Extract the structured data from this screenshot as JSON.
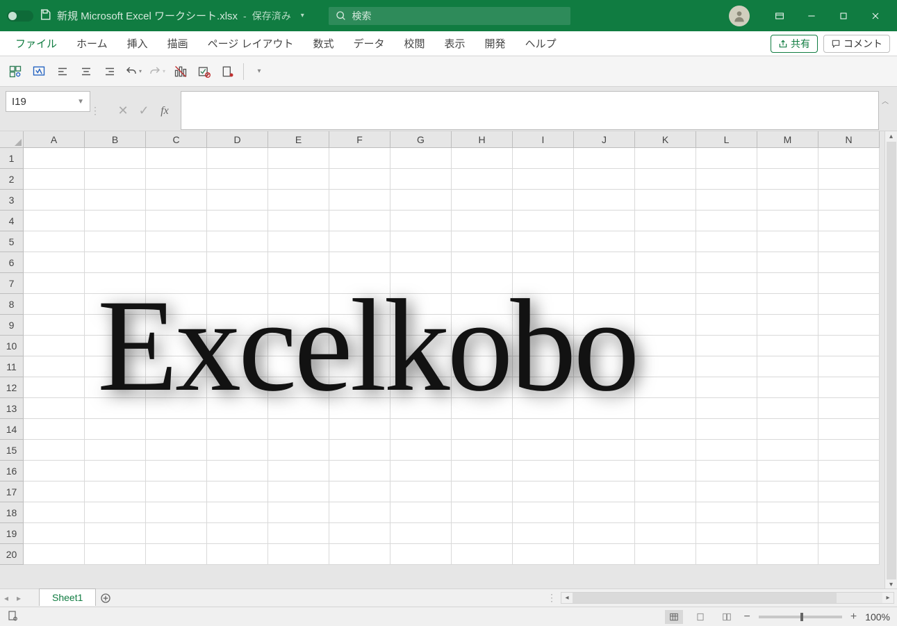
{
  "title_bar": {
    "file_name": "新規 Microsoft Excel ワークシート.xlsx",
    "save_status": "保存済み"
  },
  "search": {
    "placeholder": "検索"
  },
  "ribbon": {
    "tabs": [
      "ファイル",
      "ホーム",
      "挿入",
      "描画",
      "ページ レイアウト",
      "数式",
      "データ",
      "校閲",
      "表示",
      "開発",
      "ヘルプ"
    ],
    "share": "共有",
    "comments": "コメント"
  },
  "formula_bar": {
    "name_box": "I19",
    "formula": ""
  },
  "grid": {
    "columns": [
      "A",
      "B",
      "C",
      "D",
      "E",
      "F",
      "G",
      "H",
      "I",
      "J",
      "K",
      "L",
      "M",
      "N"
    ],
    "row_count": 20
  },
  "watermark": "Excelkobo",
  "sheet_tabs": {
    "active": "Sheet1"
  },
  "status_bar": {
    "zoom": "100%"
  }
}
